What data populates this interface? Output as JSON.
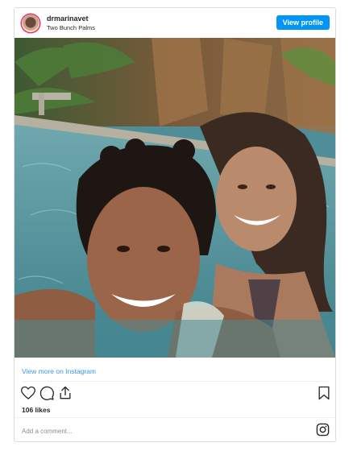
{
  "post": {
    "username": "drmarinavet",
    "location": "Two Bunch Palms",
    "view_profile_label": "View profile",
    "photo_alt": "",
    "view_more_label": "View more on Instagram",
    "likes": "106 likes",
    "comment_placeholder": "Add a comment..."
  },
  "icons": {
    "like": "heart-icon",
    "comment": "comment-icon",
    "share": "share-icon",
    "save": "bookmark-icon",
    "brand": "instagram-icon"
  },
  "colors": {
    "accent": "#0095f6",
    "link": "#3897f0",
    "text": "#262626",
    "border": "#dbdbdb",
    "pool_water": "#4f8d98"
  }
}
